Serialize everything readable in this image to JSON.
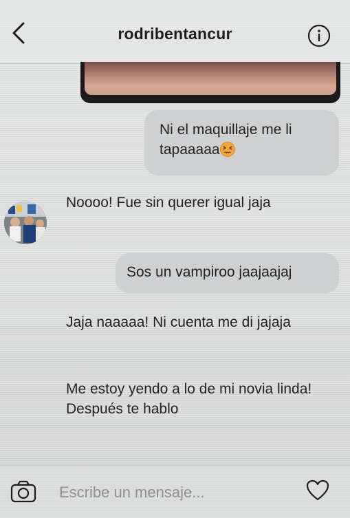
{
  "header": {
    "title": "rodribentancur",
    "back_icon": "chevron-left-icon",
    "info_icon": "info-icon"
  },
  "messages": [
    {
      "direction": "outgoing",
      "lines": [
        "Ni el maquillaje me li",
        "tapaaaaa"
      ],
      "emoji": "persevering-face-emoji"
    },
    {
      "direction": "incoming",
      "text": "Noooo! Fue sin querer igual jaja"
    },
    {
      "direction": "outgoing",
      "text": "Sos un vampiroo jaajaajaj"
    },
    {
      "direction": "incoming",
      "text": "Jaja naaaaa! Ni cuenta me di jajaja"
    },
    {
      "direction": "incoming",
      "text": "Me estoy yendo a lo de mi novia linda! Después te hablo"
    }
  ],
  "composer": {
    "placeholder": "Escribe un mensaje...",
    "camera_icon": "camera-icon",
    "like_icon": "heart-icon"
  },
  "colors": {
    "background": "#dedfdf",
    "outgoing_bubble": "#cfd0d1",
    "text": "#222222",
    "placeholder": "#8f8f8f"
  }
}
